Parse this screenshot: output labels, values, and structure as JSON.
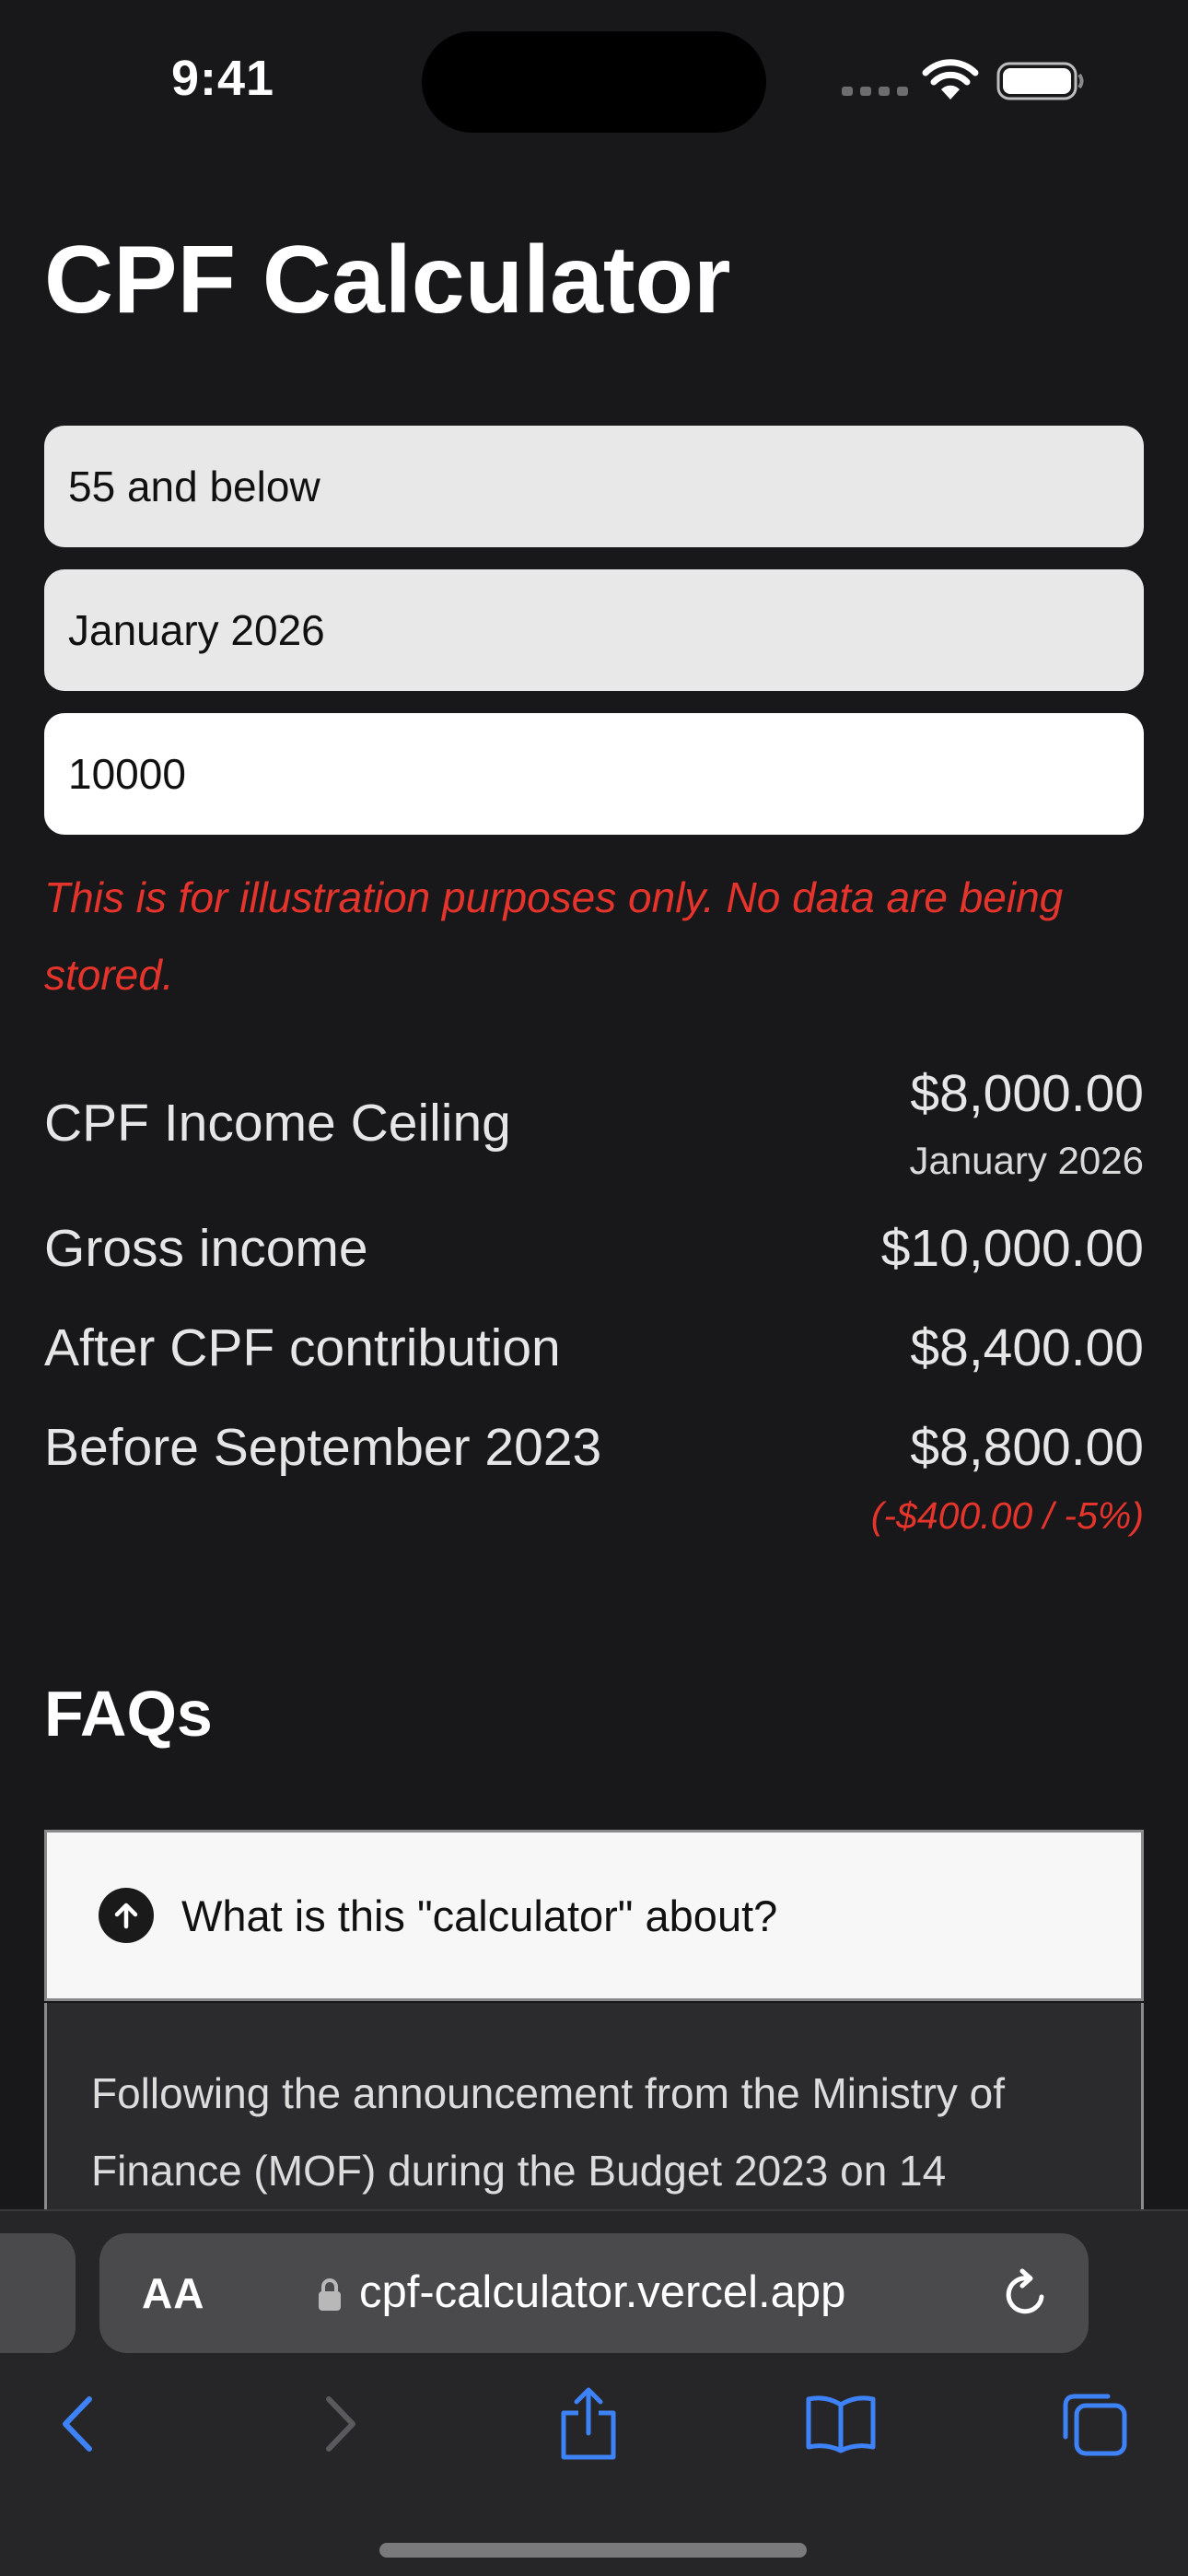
{
  "status_bar": {
    "time": "9:41"
  },
  "page": {
    "title": "CPF Calculator"
  },
  "form": {
    "age_group": "55 and below",
    "period": "January 2026",
    "income_value": "10000",
    "disclaimer": "This is for illustration purposes only. No data are being stored."
  },
  "results": {
    "ceiling": {
      "label": "CPF Income Ceiling",
      "value": "$8,000.00",
      "sub": "January 2026"
    },
    "gross": {
      "label": "Gross income",
      "value": "$10,000.00"
    },
    "after": {
      "label": "After CPF contribution",
      "value": "$8,400.00"
    },
    "before": {
      "label": "Before September 2023",
      "value": "$8,800.00",
      "diff": "(-$400.00 / -5%)"
    }
  },
  "faq": {
    "heading": "FAQs",
    "items": [
      {
        "question": "What is this \"calculator\" about?",
        "answer": "Following the announcement from the Ministry of Finance (MOF) during the Budget 2023 on 14"
      }
    ]
  },
  "browser": {
    "text_size_button": "AA",
    "url": "cpf-calculator.vercel.app"
  },
  "colors": {
    "background": "#18181a",
    "warning_red": "#e5342c",
    "toolbar_blue": "#3d82f6"
  }
}
